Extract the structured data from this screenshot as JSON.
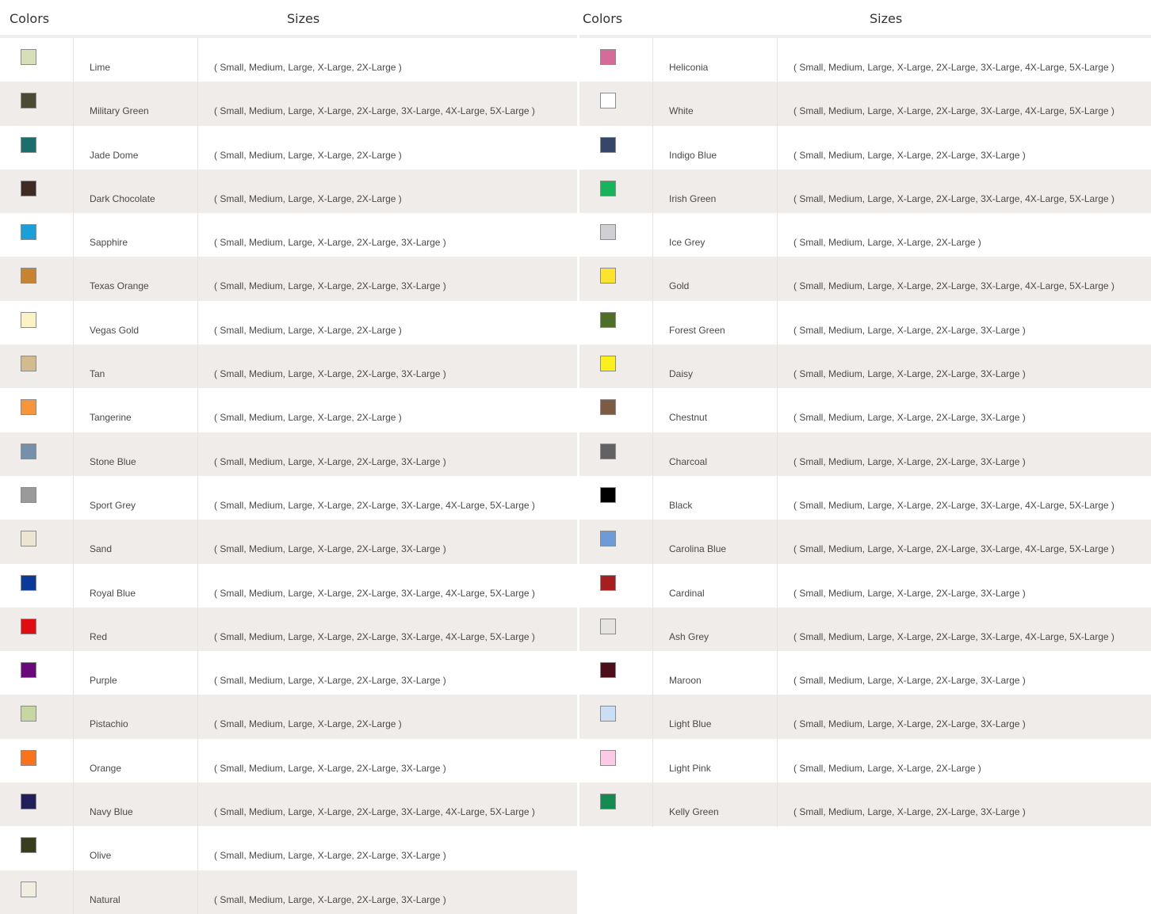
{
  "headers": {
    "colors": "Colors",
    "sizes": "Sizes"
  },
  "left": [
    {
      "name": "Lime",
      "color": "#d6dfb6",
      "sizes": "( Small, Medium, Large, X-Large, 2X-Large )"
    },
    {
      "name": "Military Green",
      "color": "#4b4a33",
      "sizes": "( Small, Medium, Large, X-Large, 2X-Large, 3X-Large, 4X-Large, 5X-Large )"
    },
    {
      "name": "Jade Dome",
      "color": "#1a6f6a",
      "sizes": "( Small, Medium, Large, X-Large, 2X-Large )"
    },
    {
      "name": "Dark Chocolate",
      "color": "#3f2a24",
      "sizes": "( Small, Medium, Large, X-Large, 2X-Large )"
    },
    {
      "name": "Sapphire",
      "color": "#1a9fd8",
      "sizes": "( Small, Medium, Large, X-Large, 2X-Large, 3X-Large )"
    },
    {
      "name": "Texas Orange",
      "color": "#c8832e",
      "sizes": "( Small, Medium, Large, X-Large, 2X-Large, 3X-Large )"
    },
    {
      "name": "Vegas Gold",
      "color": "#fdf1c6",
      "sizes": "( Small, Medium, Large, X-Large, 2X-Large )"
    },
    {
      "name": "Tan",
      "color": "#d4bb8d",
      "sizes": "( Small, Medium, Large, X-Large, 2X-Large, 3X-Large )"
    },
    {
      "name": "Tangerine",
      "color": "#f7953a",
      "sizes": "( Small, Medium, Large, X-Large, 2X-Large )"
    },
    {
      "name": "Stone Blue",
      "color": "#7590ab",
      "sizes": "( Small, Medium, Large, X-Large, 2X-Large, 3X-Large )"
    },
    {
      "name": "Sport Grey",
      "color": "#9a9a9a",
      "sizes": "( Small, Medium, Large, X-Large, 2X-Large, 3X-Large, 4X-Large, 5X-Large )"
    },
    {
      "name": "Sand",
      "color": "#ece5d1",
      "sizes": "( Small, Medium, Large, X-Large, 2X-Large, 3X-Large )"
    },
    {
      "name": "Royal Blue",
      "color": "#0a3a99",
      "sizes": "( Small, Medium, Large, X-Large, 2X-Large, 3X-Large, 4X-Large, 5X-Large )"
    },
    {
      "name": "Red",
      "color": "#e20b12",
      "sizes": "( Small, Medium, Large, X-Large, 2X-Large, 3X-Large, 4X-Large, 5X-Large )"
    },
    {
      "name": "Purple",
      "color": "#6a0a7a",
      "sizes": "( Small, Medium, Large, X-Large, 2X-Large, 3X-Large )"
    },
    {
      "name": "Pistachio",
      "color": "#c6d7a2",
      "sizes": "( Small, Medium, Large, X-Large, 2X-Large )"
    },
    {
      "name": "Orange",
      "color": "#f9731b",
      "sizes": "( Small, Medium, Large, X-Large, 2X-Large, 3X-Large )"
    },
    {
      "name": "Navy Blue",
      "color": "#21205a",
      "sizes": "( Small, Medium, Large, X-Large, 2X-Large, 3X-Large, 4X-Large, 5X-Large )"
    },
    {
      "name": "Olive",
      "color": "#373d1d",
      "sizes": "( Small, Medium, Large, X-Large, 2X-Large, 3X-Large )"
    },
    {
      "name": "Natural",
      "color": "#f2ede0",
      "sizes": "( Small, Medium, Large, X-Large, 2X-Large, 3X-Large )"
    }
  ],
  "right": [
    {
      "name": "Heliconia",
      "color": "#d56b99",
      "sizes": "( Small, Medium, Large, X-Large, 2X-Large, 3X-Large, 4X-Large, 5X-Large )"
    },
    {
      "name": "White",
      "color": "#ffffff",
      "sizes": "( Small, Medium, Large, X-Large, 2X-Large, 3X-Large, 4X-Large, 5X-Large )"
    },
    {
      "name": "Indigo Blue",
      "color": "#34476a",
      "sizes": "( Small, Medium, Large, X-Large, 2X-Large, 3X-Large )"
    },
    {
      "name": "Irish Green",
      "color": "#17b45b",
      "sizes": "( Small, Medium, Large, X-Large, 2X-Large, 3X-Large, 4X-Large, 5X-Large )"
    },
    {
      "name": "Ice Grey",
      "color": "#cfcfd4",
      "sizes": "( Small, Medium, Large, X-Large, 2X-Large )"
    },
    {
      "name": "Gold",
      "color": "#fde32d",
      "sizes": "( Small, Medium, Large, X-Large, 2X-Large, 3X-Large, 4X-Large, 5X-Large )"
    },
    {
      "name": "Forest Green",
      "color": "#4f6e28",
      "sizes": "( Small, Medium, Large, X-Large, 2X-Large, 3X-Large )"
    },
    {
      "name": "Daisy",
      "color": "#fbef1e",
      "sizes": "( Small, Medium, Large, X-Large, 2X-Large, 3X-Large )"
    },
    {
      "name": "Chestnut",
      "color": "#7c5a44",
      "sizes": "( Small, Medium, Large, X-Large, 2X-Large, 3X-Large )"
    },
    {
      "name": "Charcoal",
      "color": "#626264",
      "sizes": "( Small, Medium, Large, X-Large, 2X-Large, 3X-Large )"
    },
    {
      "name": "Black",
      "color": "#000000",
      "sizes": "( Small, Medium, Large, X-Large, 2X-Large, 3X-Large, 4X-Large, 5X-Large )"
    },
    {
      "name": "Carolina Blue",
      "color": "#6c9bd8",
      "sizes": "( Small, Medium, Large, X-Large, 2X-Large, 3X-Large, 4X-Large, 5X-Large )"
    },
    {
      "name": "Cardinal",
      "color": "#a71e20",
      "sizes": "( Small, Medium, Large, X-Large, 2X-Large, 3X-Large )"
    },
    {
      "name": "Ash Grey",
      "color": "#e6e4e0",
      "sizes": "( Small, Medium, Large, X-Large, 2X-Large, 3X-Large, 4X-Large, 5X-Large )"
    },
    {
      "name": "Maroon",
      "color": "#4d101a",
      "sizes": "( Small, Medium, Large, X-Large, 2X-Large, 3X-Large )"
    },
    {
      "name": "Light Blue",
      "color": "#cadff6",
      "sizes": "( Small, Medium, Large, X-Large, 2X-Large, 3X-Large )"
    },
    {
      "name": "Light Pink",
      "color": "#fbcbe5",
      "sizes": "( Small, Medium, Large, X-Large, 2X-Large )"
    },
    {
      "name": "Kelly Green",
      "color": "#158a51",
      "sizes": "( Small, Medium, Large, X-Large, 2X-Large, 3X-Large )"
    }
  ]
}
